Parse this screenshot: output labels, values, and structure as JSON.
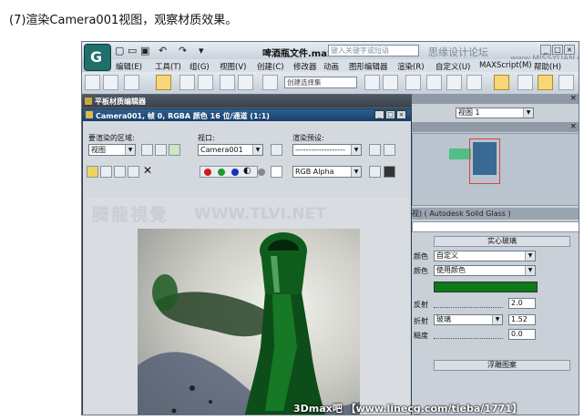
{
  "caption": "(7)渲染Camera001视图，观察材质效果。",
  "app": {
    "window_title": "啤酒瓶文件.max",
    "search_placeholder": "键入关键字或短语",
    "watermark_forum": "思缘设计论坛",
    "watermark_site": "www.MISSYUAN.COM",
    "menu": [
      "编辑(E)",
      "工具(T)",
      "组(G)",
      "视图(V)",
      "创建(C)",
      "修改器",
      "动画",
      "图形编辑器",
      "渲染(R)",
      "自定义(U)",
      "MAXScript(M)",
      "帮助(H)"
    ],
    "toolbar_selection": "创建选择集",
    "material_editor_title": "平板材质编辑器",
    "quick_access_icons": [
      "new-icon",
      "open-icon",
      "save-icon",
      "undo-icon",
      "redo-icon",
      "dropdown-icon"
    ],
    "window_buttons": [
      "_",
      "□",
      "×"
    ]
  },
  "render_frame": {
    "title": "Camera001, 帧 0, RGBA 颜色 16 位/通道 (1:1)",
    "buttons": [
      "_",
      "□",
      "×"
    ],
    "area_label": "要渲染的区域:",
    "area_value": "视图",
    "viewport_label": "视口:",
    "viewport_value": "Camera001",
    "preset_label": "渲染预设:",
    "preset_value": "-------------------",
    "channel_value": "RGB Alpha",
    "watermark_cn": "腾龍視覺",
    "watermark_url": "WWW.TLVI.NET",
    "channel_colors": [
      "#d11a1a",
      "#1d9a2a",
      "#1a2fb8"
    ]
  },
  "right_panel": {
    "viewport_label": "视图 1",
    "material_header": "视) ( Autodesk Solid Glass )",
    "rollout_title": "实心玻璃",
    "color_label": "颜色",
    "color_value": "自定义",
    "color2_label": "颜色",
    "color2_value": "使用颜色",
    "swatch_color": "#0b7a17",
    "reflect_label": "反射",
    "reflect_value": "2.0",
    "refract_label": "折射",
    "refract_value": "玻璃",
    "refract_num": "1.52",
    "rough_label": "糙度",
    "rough_value": "0.0",
    "bump_title": "浮雕图案"
  },
  "bottom_watermark": "3Dmax吧 【www.linecg.com/tieba/1771】"
}
